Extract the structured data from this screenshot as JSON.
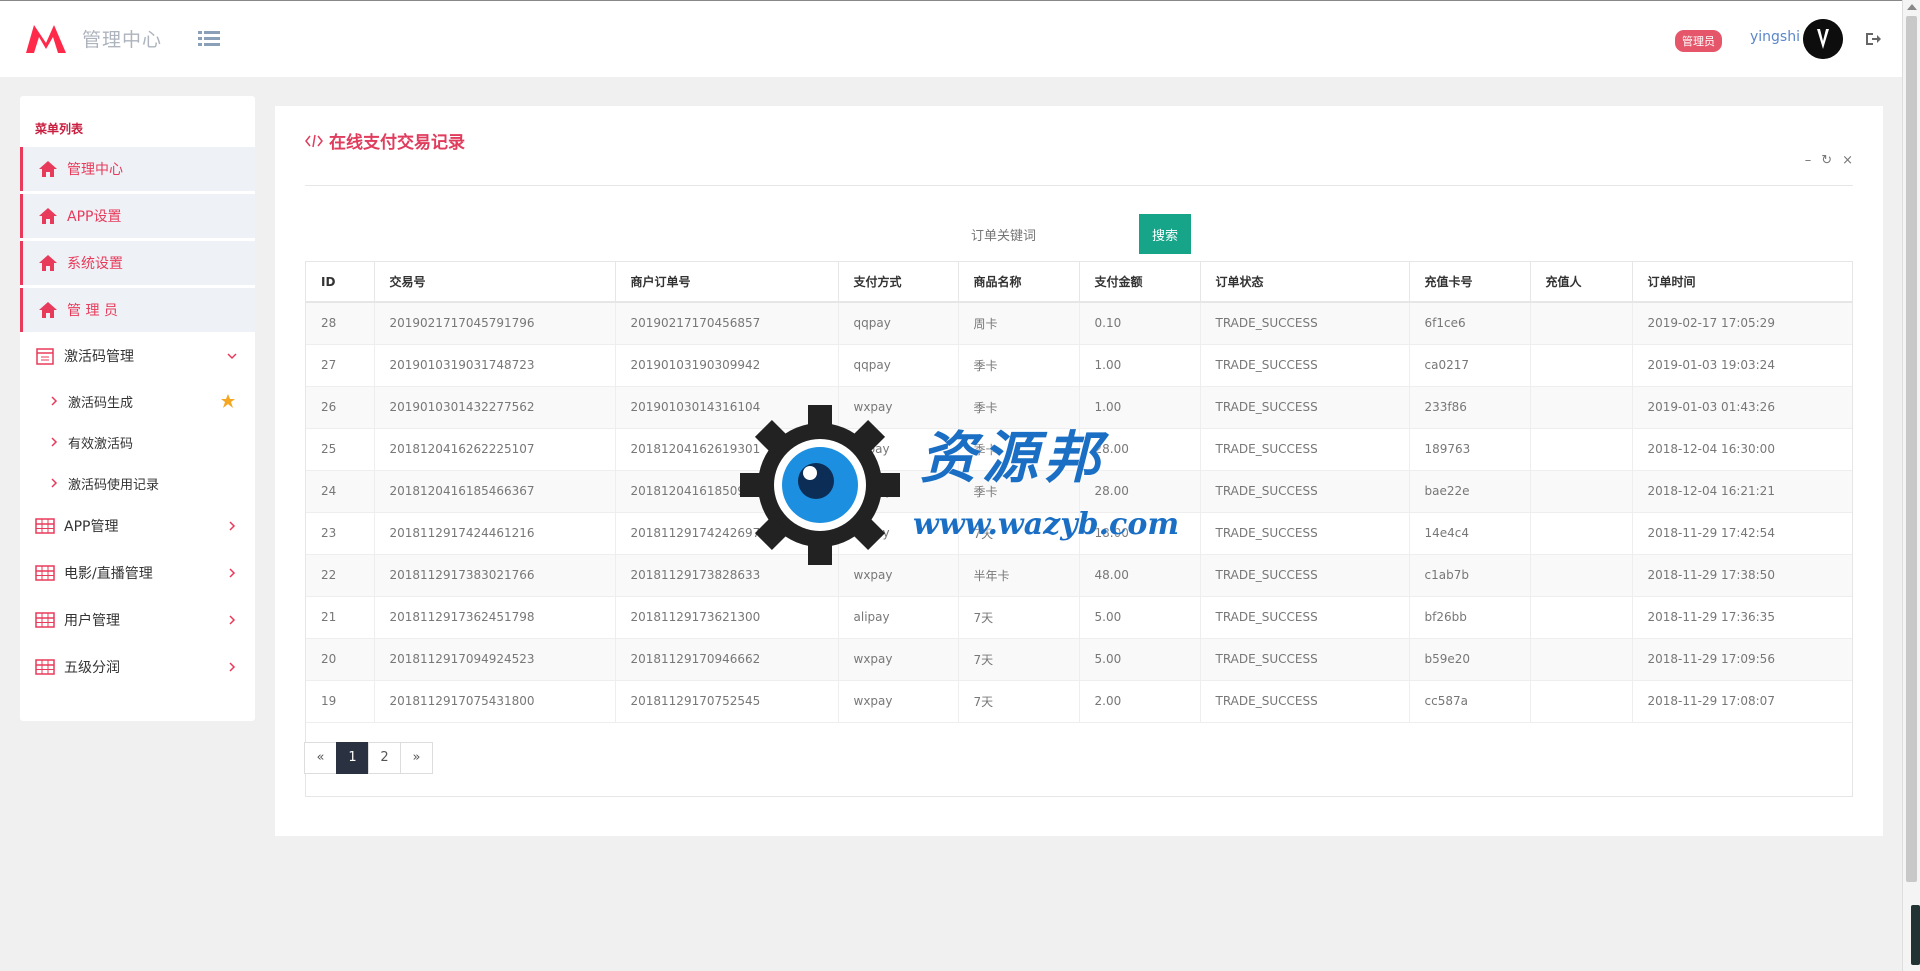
{
  "header": {
    "brand": "管理中心",
    "role_badge": "管理员",
    "username": "yingshi"
  },
  "sidebar": {
    "title": "菜单列表",
    "items": [
      {
        "label": "管理中心"
      },
      {
        "label": "APP设置"
      },
      {
        "label": "系统设置"
      },
      {
        "label": "管 理 员"
      },
      {
        "label": "激活码管理"
      },
      {
        "label": "APP管理"
      },
      {
        "label": "电影/直播管理"
      },
      {
        "label": "用户管理"
      },
      {
        "label": "五级分润"
      }
    ],
    "subitems": [
      {
        "label": "激活码生成"
      },
      {
        "label": "有效激活码"
      },
      {
        "label": "激活码使用记录"
      }
    ]
  },
  "panel": {
    "title": "在线支付交易记录",
    "search_placeholder": "订单关键词",
    "search_button": "搜索"
  },
  "table": {
    "columns": [
      "ID",
      "交易号",
      "商户订单号",
      "支付方式",
      "商品名称",
      "支付金额",
      "订单状态",
      "充值卡号",
      "充值人",
      "订单时间"
    ],
    "rows": [
      [
        "28",
        "2019021717045791796",
        "20190217170456857",
        "qqpay",
        "周卡",
        "0.10",
        "TRADE_SUCCESS",
        "6f1ce6",
        "",
        "2019-02-17 17:05:29"
      ],
      [
        "27",
        "2019010319031748723",
        "20190103190309942",
        "qqpay",
        "季卡",
        "1.00",
        "TRADE_SUCCESS",
        "ca0217",
        "",
        "2019-01-03 19:03:24"
      ],
      [
        "26",
        "2019010301432277562",
        "20190103014316104",
        "wxpay",
        "季卡",
        "1.00",
        "TRADE_SUCCESS",
        "233f86",
        "",
        "2019-01-03 01:43:26"
      ],
      [
        "25",
        "2018120416262225107",
        "20181204162619301",
        "alipay",
        "季卡",
        "28.00",
        "TRADE_SUCCESS",
        "189763",
        "",
        "2018-12-04 16:30:00"
      ],
      [
        "24",
        "2018120416185466367",
        "20181204161850928",
        "wxpay",
        "季卡",
        "28.00",
        "TRADE_SUCCESS",
        "bae22e",
        "",
        "2018-12-04 16:21:21"
      ],
      [
        "23",
        "2018112917424461216",
        "20181129174242697",
        "alipay",
        "7天",
        "18.00",
        "TRADE_SUCCESS",
        "14e4c4",
        "",
        "2018-11-29 17:42:54"
      ],
      [
        "22",
        "2018112917383021766",
        "20181129173828633",
        "wxpay",
        "半年卡",
        "48.00",
        "TRADE_SUCCESS",
        "c1ab7b",
        "",
        "2018-11-29 17:38:50"
      ],
      [
        "21",
        "2018112917362451798",
        "20181129173621300",
        "alipay",
        "7天",
        "5.00",
        "TRADE_SUCCESS",
        "bf26bb",
        "",
        "2018-11-29 17:36:35"
      ],
      [
        "20",
        "2018112917094924523",
        "20181129170946662",
        "wxpay",
        "7天",
        "5.00",
        "TRADE_SUCCESS",
        "b59e20",
        "",
        "2018-11-29 17:09:56"
      ],
      [
        "19",
        "2018112917075431800",
        "20181129170752545",
        "wxpay",
        "7天",
        "2.00",
        "TRADE_SUCCESS",
        "cc587a",
        "",
        "2018-11-29 17:08:07"
      ]
    ]
  },
  "pagination": {
    "prev": "«",
    "pages": [
      "1",
      "2"
    ],
    "current": "1",
    "next": "»"
  },
  "watermark": {
    "text": "资源邦",
    "url": "www.wazyb.com"
  },
  "colors": {
    "accent": "#e83a5a",
    "search_button": "#17a58a",
    "active_page": "#2a3140"
  }
}
